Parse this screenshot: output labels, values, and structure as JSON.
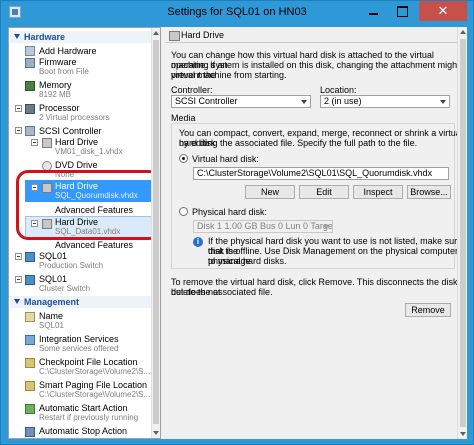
{
  "window": {
    "title": "Settings for SQL01 on HN03",
    "close_glyph": "✕"
  },
  "tree": {
    "hardware_header": "Hardware",
    "management_header": "Management",
    "items": {
      "add_hardware": "Add Hardware",
      "firmware": "Firmware",
      "firmware_sub": "Boot from File",
      "memory": "Memory",
      "memory_sub": "8192 MB",
      "processor": "Processor",
      "processor_sub": "2 Virtual processors",
      "scsi": "SCSI Controller",
      "hd1": "Hard Drive",
      "hd1_sub": "VM01_disk_1.vhdx",
      "dvd": "DVD Drive",
      "dvd_sub": "None",
      "hd2": "Hard Drive",
      "hd2_sub": "SQL_Quorumdisk.vhdx",
      "hd2_adv": "Advanced Features",
      "hd3": "Hard Drive",
      "hd3_sub": "SQL_Data01.vhdx",
      "hd3_adv": "Advanced Features",
      "net1": "SQL01",
      "net1_sub": "Production Switch",
      "net2": "SQL01",
      "net2_sub": "Cluster Switch",
      "name": "Name",
      "name_sub": "SQL01",
      "integration": "Integration Services",
      "integration_sub": "Some services offered",
      "checkpoint": "Checkpoint File Location",
      "checkpoint_sub": "C:\\ClusterStorage\\Volume2\\S...",
      "paging": "Smart Paging File Location",
      "paging_sub": "C:\\ClusterStorage\\Volume2\\S...",
      "autostart": "Automatic Start Action",
      "autostart_sub": "Restart if previously running",
      "autostop": "Automatic Stop Action",
      "autostop_sub": "Save"
    }
  },
  "panel": {
    "header": "Hard Drive",
    "intro": [
      "You can change how this virtual hard disk is attached to the virtual machine. If an",
      "operating system is installed on this disk, changing the attachment might prevent the",
      "virtual machine from starting."
    ],
    "controller_label": "Controller:",
    "controller_value": "SCSI Controller",
    "location_label": "Location:",
    "location_value": "2 (in use)",
    "media_label": "Media",
    "media_desc": [
      "You can compact, convert, expand, merge, reconnect or shrink a virtual hard disk",
      "by editing the associated file. Specify the full path to the file."
    ],
    "vhd_label": "Virtual hard disk:",
    "vhd_path": "C:\\ClusterStorage\\Volume2\\SQL01\\SQL_Quorumdisk.vhdx",
    "buttons": {
      "new": "New",
      "edit": "Edit",
      "inspect": "Inspect",
      "browse": "Browse..."
    },
    "physical_label": "Physical hard disk:",
    "physical_value": "Disk 1 1.00 GB Bus 0 Lun 0 Target 0",
    "physical_note": [
      "If the physical hard disk you want to use is not listed, make sure that the",
      "disk is offline. Use Disk Management on the physical computer to manage",
      "physical hard disks."
    ],
    "remove_desc": [
      "To remove the virtual hard disk, click Remove. This disconnects the disk but does not",
      "delete the associated file."
    ],
    "remove_button": "Remove"
  },
  "colors": {
    "title_bar": "#2f98d6",
    "selection": "#3399ff",
    "highlight_ring": "#d0121b",
    "close_button": "#c7504a"
  }
}
